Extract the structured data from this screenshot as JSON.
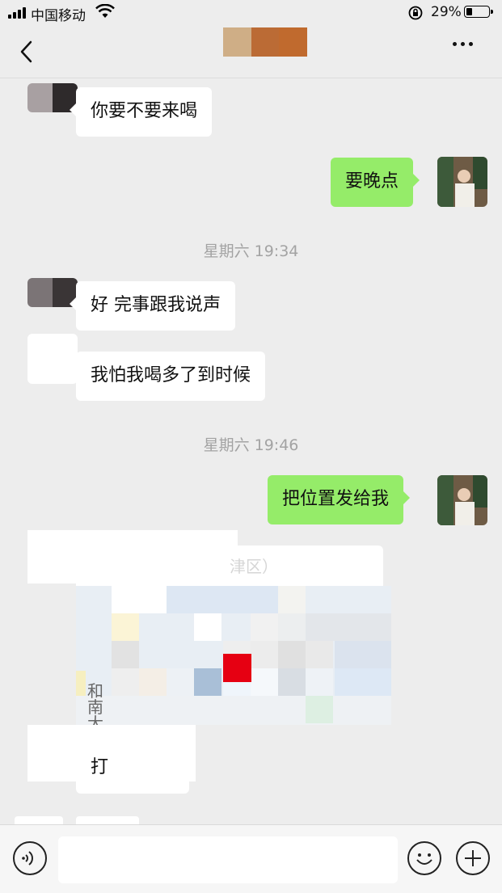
{
  "status_bar": {
    "carrier": "中国移动",
    "battery_percent": "29%",
    "battery_level": 0.29
  },
  "nav": {
    "back_icon": "chevron-left-icon",
    "more_icon": "more-dots-icon",
    "title_colors": [
      "#cfae86",
      "#bb6b35",
      "#c06a2e"
    ]
  },
  "messages": [
    {
      "side": "in",
      "text": "你要不要来喝"
    },
    {
      "side": "out",
      "text": "要晚点"
    },
    {
      "timestamp": "星期六 19:34"
    },
    {
      "side": "in",
      "text": "好 完事跟我说声"
    },
    {
      "side": "in",
      "text": "我怕我喝多了到时候"
    },
    {
      "timestamp": "星期六 19:46"
    },
    {
      "side": "out",
      "text": "把位置发给我"
    },
    {
      "side": "in",
      "type": "location",
      "partial_title": "津区）"
    },
    {
      "side": "in",
      "partial_text": "打"
    }
  ],
  "location_card": {
    "map_text": "和南大"
  },
  "colors": {
    "background": "#ededed",
    "incoming_bubble": "#ffffff",
    "outgoing_bubble": "#95ec69",
    "timestamp": "#a3a3a3",
    "location_pin": "#e60012"
  },
  "input_bar": {
    "voice_icon": "voice-icon",
    "emoji_icon": "emoji-icon",
    "plus_icon": "plus-icon",
    "input_value": ""
  }
}
